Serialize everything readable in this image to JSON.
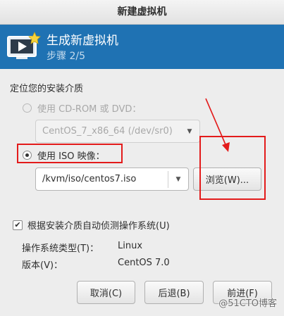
{
  "window": {
    "title": "新建虚拟机"
  },
  "banner": {
    "title": "生成新虚拟机",
    "step": "步骤 2/5"
  },
  "section": {
    "title": "定位您的安装介质"
  },
  "cdrom": {
    "label": "使用  CD-ROM 或  DVD：",
    "selected": false,
    "enabled": false,
    "device": "CentOS_7_x86_64 (/dev/sr0)"
  },
  "iso": {
    "label": "使用  ISO 映像：",
    "selected": true,
    "path": "/kvm/iso/centos7.iso",
    "browse_label": "浏览(W)..."
  },
  "autodetect": {
    "label": "根据安装介质自动侦测操作系统(U)",
    "checked": true,
    "os_type_label": "操作系统类型(T)：",
    "os_type_value": "Linux",
    "version_label": "版本(V)：",
    "version_value": "CentOS 7.0"
  },
  "buttons": {
    "cancel": "取消(C)",
    "back": "后退(B)",
    "forward": "前进(F)"
  },
  "watermark": "@51CTO博客",
  "colors": {
    "banner": "#1f72b3",
    "annotation": "#e31b1b"
  },
  "icons": {
    "banner": "vm-screen-star-icon",
    "combo": "chevron-down-icon",
    "check": "check-icon"
  }
}
